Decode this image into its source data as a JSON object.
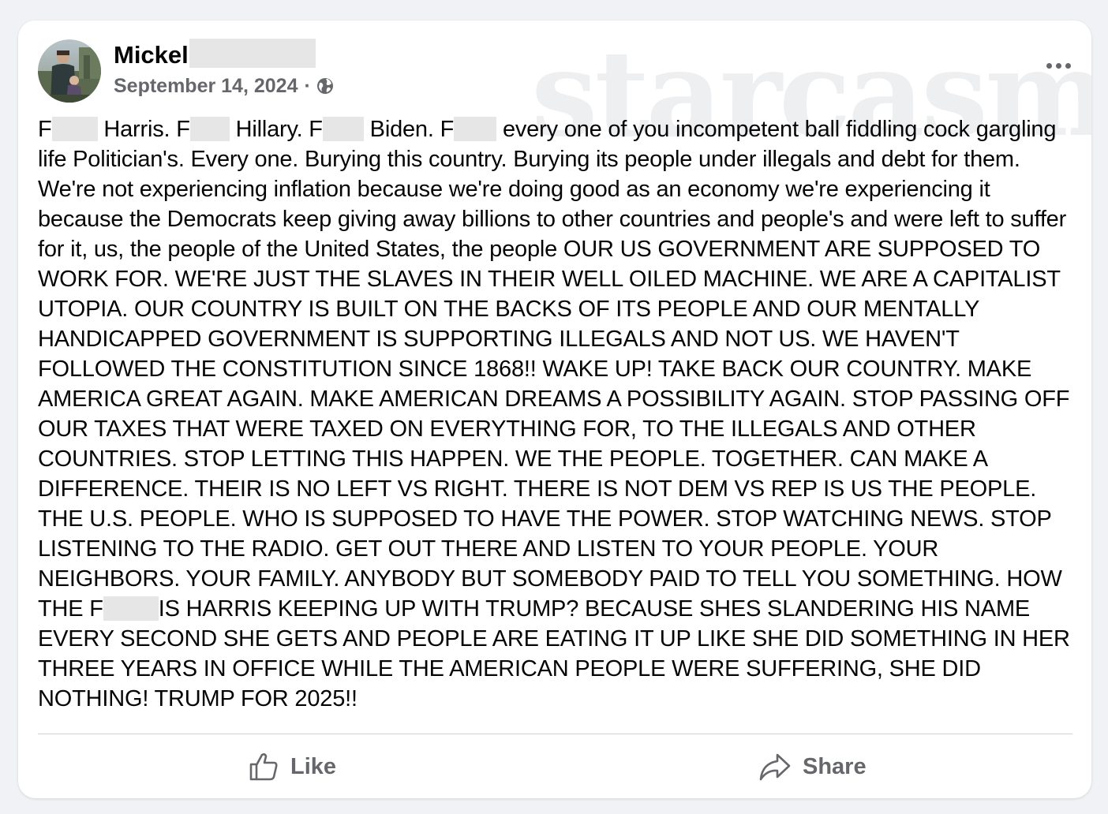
{
  "post": {
    "author": {
      "first_name": "Mickel",
      "avatar_icon": "profile-photo"
    },
    "date": "September 14, 2024",
    "separator": "·",
    "audience_icon": "globe-icon",
    "watermark": "starcasm",
    "body_segments": [
      {
        "text": "F"
      },
      {
        "redacted": true,
        "w": 58
      },
      {
        "text": " Harris. F"
      },
      {
        "redacted": true,
        "w": 50
      },
      {
        "text": " Hillary. F"
      },
      {
        "redacted": true,
        "w": 52
      },
      {
        "text": " Biden. F"
      },
      {
        "redacted": true,
        "w": 54
      },
      {
        "text": " every one of you incompetent ball fiddling cock gargling life Politician's. Every one. Burying this country. Burying its people under illegals and debt for them. We're not experiencing inflation because we're doing good as an economy we're experiencing it because the Democrats keep giving away billions to other countries and people's and were left to suffer for it, us, the people of the United States, the people OUR US GOVERNMENT ARE SUPPOSED TO WORK FOR. WE'RE JUST THE SLAVES IN THEIR WELL OILED MACHINE. WE ARE A CAPITALIST UTOPIA. OUR COUNTRY IS BUILT ON THE BACKS OF ITS PEOPLE AND OUR MENTALLY HANDICAPPED GOVERNMENT IS SUPPORTING ILLEGALS AND NOT US. WE HAVEN'T FOLLOWED THE CONSTITUTION SINCE 1868!! WAKE UP! TAKE BACK OUR COUNTRY. MAKE AMERICA GREAT AGAIN. MAKE AMERICAN DREAMS A POSSIBILITY AGAIN. STOP PASSING OFF OUR TAXES THAT WERE TAXED ON EVERYTHING FOR, TO THE ILLEGALS AND OTHER COUNTRIES. STOP LETTING THIS HAPPEN. WE THE PEOPLE. TOGETHER. CAN MAKE A DIFFERENCE. THEIR IS NO LEFT VS RIGHT. THERE IS NOT DEM VS REP IS US THE PEOPLE. THE U.S. PEOPLE. WHO IS SUPPOSED TO HAVE THE POWER. STOP WATCHING NEWS. STOP LISTENING TO THE RADIO. GET OUT THERE AND LISTEN TO YOUR PEOPLE. YOUR NEIGHBORS. YOUR FAMILY. ANYBODY BUT SOMEBODY PAID TO TELL YOU SOMETHING. HOW THE F"
      },
      {
        "redacted": true,
        "w": 70
      },
      {
        "text": "IS HARRIS KEEPING UP WITH TRUMP? BECAUSE SHES SLANDERING HIS NAME EVERY SECOND SHE GETS AND PEOPLE ARE EATING IT UP LIKE SHE DID SOMETHING IN HER THREE YEARS IN OFFICE WHILE THE AMERICAN PEOPLE WERE SUFFERING, SHE DID NOTHING! TRUMP FOR 2025!!"
      }
    ]
  },
  "actions": {
    "like_label": "Like",
    "like_icon": "thumbs-up-icon",
    "share_label": "Share",
    "share_icon": "share-arrow-icon"
  },
  "menu_icon": "more-options-icon",
  "colors": {
    "background": "#f0f2f5",
    "card": "#ffffff",
    "text": "#050505",
    "secondary_text": "#65676b",
    "redaction": "#e6e6e6",
    "divider": "#ced0d4"
  }
}
